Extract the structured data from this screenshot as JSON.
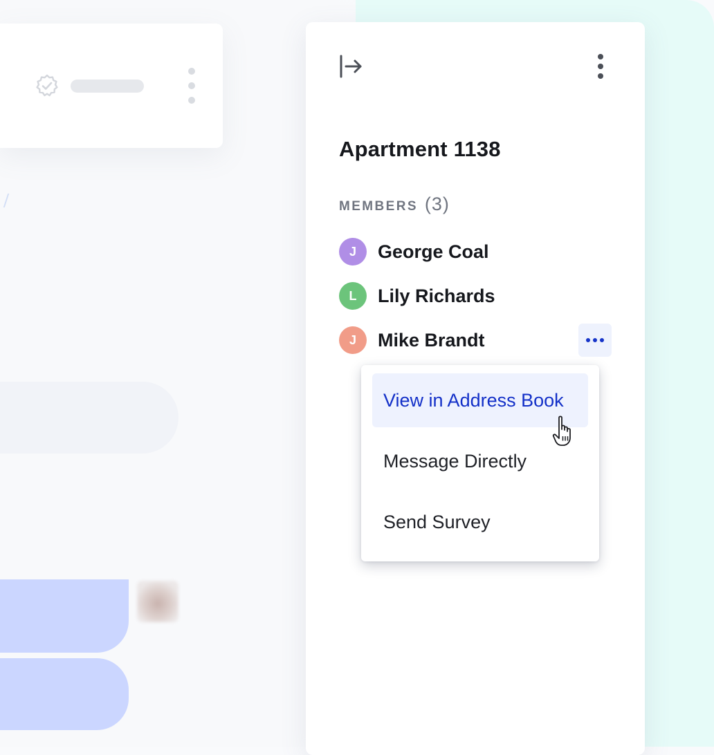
{
  "panel": {
    "title": "Apartment 1138",
    "members_label": "MEMBERS",
    "members_count": "(3)",
    "members": [
      {
        "initial": "J",
        "name": "George Coal",
        "color": "#b08ee6"
      },
      {
        "initial": "L",
        "name": "Lily Richards",
        "color": "#6cc47b"
      },
      {
        "initial": "J",
        "name": "Mike Brandt",
        "color": "#f19c88"
      }
    ]
  },
  "menu": {
    "items": [
      {
        "label": "View in Address Book",
        "state": "hovered"
      },
      {
        "label": "Message Directly"
      },
      {
        "label": "Send Survey"
      }
    ]
  },
  "icons": {
    "collapse": "collapse-panel-icon",
    "panel_more": "kebab-vertical-icon",
    "member_more": "ellipsis-horizontal-icon",
    "verified": "verified-badge-icon",
    "cursor": "hand-pointer-icon"
  },
  "colors": {
    "accent": "#1330c8",
    "mint_background": "#e6fbf8",
    "chat_bubble": "#cbd6ff"
  }
}
